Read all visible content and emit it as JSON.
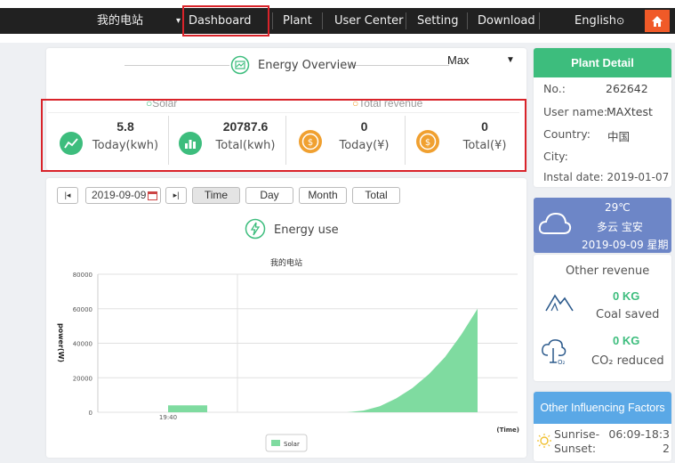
{
  "nav": {
    "station": "我的电站",
    "dashboard": "Dashboard",
    "plant": "Plant",
    "user_center": "User Center",
    "setting": "Setting",
    "download": "Download",
    "language": "English",
    "caret": "▾",
    "lang_icon": "⊙"
  },
  "overview": {
    "title": "Energy Overview",
    "select_value": "Max",
    "select_caret": "▼",
    "solar_label": "Solar",
    "revenue_label": "Total revenue",
    "stats": [
      {
        "value": "5.8",
        "label": "Today(kwh)",
        "icon": "line-chart-icon",
        "color": "#3dbd7d"
      },
      {
        "value": "20787.6",
        "label": "Total(kwh)",
        "icon": "bar-chart-icon",
        "color": "#3dbd7d"
      },
      {
        "value": "0",
        "label": "Today(¥)",
        "icon": "coin-icon",
        "color": "#f0a030"
      },
      {
        "value": "0",
        "label": "Total(¥)",
        "icon": "coin-icon",
        "color": "#f0a030"
      }
    ]
  },
  "energy_use": {
    "date": "2019-09-09",
    "btn_time": "Time",
    "btn_day": "Day",
    "btn_month": "Month",
    "btn_total": "Total",
    "title": "Energy use"
  },
  "chart_data": {
    "type": "area",
    "title": "我的电站",
    "ylabel": "power(W)",
    "xlabel": "(Time)",
    "ylim": [
      0,
      80000
    ],
    "yticks": [
      "80000",
      "60000",
      "40000",
      "20000",
      "0"
    ],
    "xtick": "19:40",
    "series": [
      {
        "name": "Solar",
        "color": "#7fdba0",
        "points": [
          [
            0.0,
            4000
          ],
          [
            0.12,
            4000
          ],
          [
            0.12,
            0
          ],
          [
            0.55,
            0
          ],
          [
            0.6,
            1000
          ],
          [
            0.65,
            3500
          ],
          [
            0.7,
            8000
          ],
          [
            0.75,
            14000
          ],
          [
            0.8,
            22000
          ],
          [
            0.85,
            32000
          ],
          [
            0.9,
            45000
          ],
          [
            0.95,
            60000
          ],
          [
            0.95,
            0
          ]
        ]
      }
    ],
    "legend": "Solar"
  },
  "plant_detail": {
    "title": "Plant Detail",
    "no_label": "No.:",
    "no_value": "262642",
    "user_label": "User name:",
    "user_value": "MAXtest",
    "country_label": "Country:",
    "country_value": "中国",
    "city_label": "City:",
    "city_value": "",
    "install_label": "Instal date:",
    "install_value": "2019-01-07"
  },
  "weather": {
    "temp": "29℃",
    "desc": "多云 宝安",
    "date": "2019-09-09 星期"
  },
  "other_revenue": {
    "title": "Other revenue",
    "coal_value": "0 KG",
    "coal_label": "Coal saved",
    "co2_value": "0 KG",
    "co2_label": "CO₂ reduced"
  },
  "factors": {
    "title": "Other Influencing Factors",
    "sunrise_label": "Sunrise-Sunset:",
    "sunrise_value": "06:09-18:32"
  },
  "colors": {
    "nav_bg": "#212121",
    "green": "#3dbd7d",
    "blue": "#5aa8e6",
    "weather_bg": "#6d86c7",
    "area": "#7fdba0",
    "highlight": "#d9232a"
  }
}
